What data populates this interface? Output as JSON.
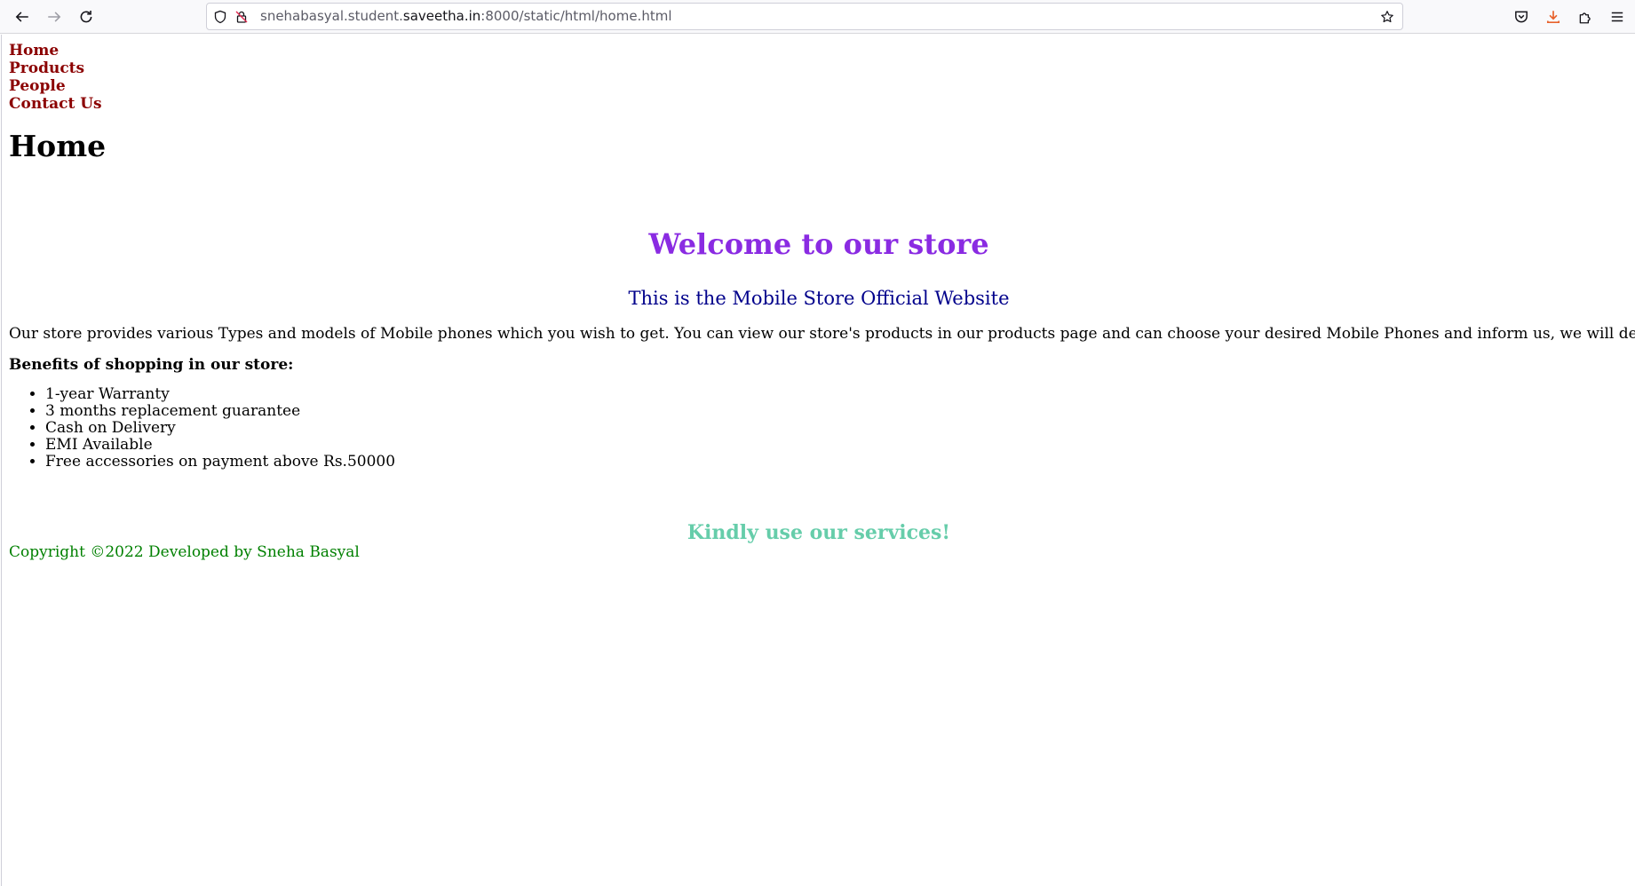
{
  "browser": {
    "url_prefix": "snehabasyal.student.",
    "url_domain": "saveetha.in",
    "url_suffix": ":8000/static/html/home.html",
    "icons": {
      "back": "back-arrow-icon",
      "forward": "forward-arrow-icon",
      "reload": "reload-icon",
      "shield": "shield-icon",
      "insecure": "insecure-lock-icon",
      "bookmark": "star-icon",
      "pocket": "pocket-icon",
      "downloads": "download-icon",
      "extensions": "extensions-icon",
      "menu": "hamburger-menu-icon"
    },
    "download_color": "#e8622c"
  },
  "nav": {
    "items": [
      {
        "label": "Home"
      },
      {
        "label": "Products"
      },
      {
        "label": "People"
      },
      {
        "label": "Contact Us"
      }
    ]
  },
  "main": {
    "title": "Home",
    "welcome": "Welcome to our store",
    "subtitle": "This is the Mobile Store Official Website",
    "intro": "Our store provides various Types and models of Mobile phones which you wish to get. You can view our store's products in our products page and can choose your desired Mobile Phones and inform us, we will deliver it.",
    "benefits_heading": "Benefits of shopping in our store:",
    "benefits": [
      "1-year Warranty",
      "3 months replacement guarantee",
      "Cash on Delivery",
      "EMI Available",
      "Free accessories on payment above Rs.50000"
    ],
    "closing": "Kindly use our services!",
    "copyright": "Copyright ©2022 Developed by Sneha Basyal"
  },
  "colors": {
    "nav_link": "#8b0000",
    "welcome": "#8a2be2",
    "subtitle": "#00008b",
    "closing": "#66cdaa",
    "copyright": "#008000"
  }
}
